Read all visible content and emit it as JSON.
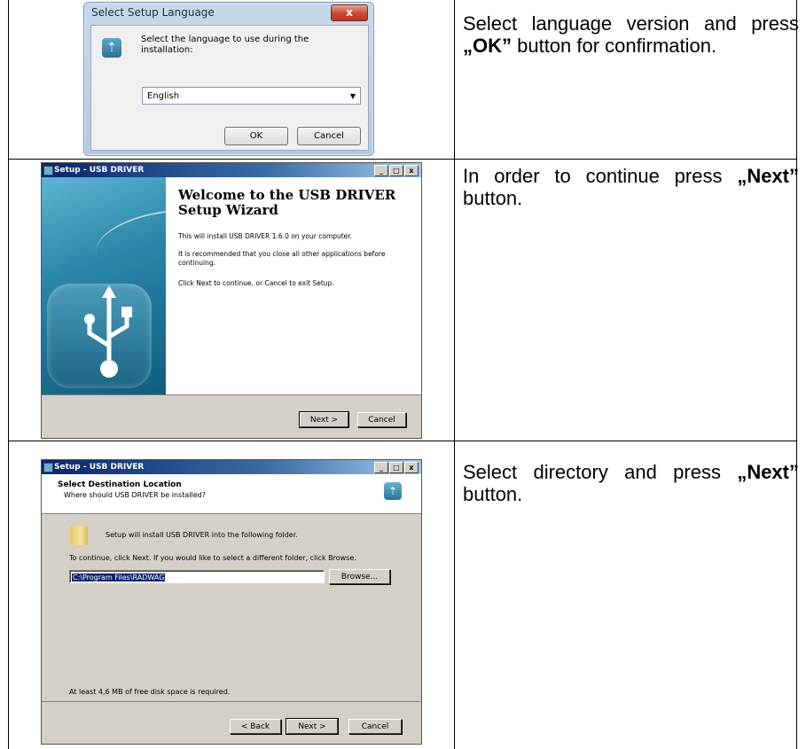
{
  "rows": [
    {
      "instruction_parts": [
        "Select language version and press ",
        "„OK”",
        " button for confirmation."
      ],
      "dialog": {
        "title": "Select Setup Language",
        "close_glyph": "x",
        "icon": "usb-setup-icon",
        "message": "Select the language to use during the installation:",
        "language_selected": "English",
        "ok_label": "OK",
        "cancel_label": "Cancel"
      }
    },
    {
      "instruction_parts": [
        "In order to continue press ",
        "„Next”",
        " button."
      ],
      "wizard": {
        "title": "Setup - USB DRIVER",
        "heading_line1": "Welcome to the USB DRIVER",
        "heading_line2": "Setup Wizard",
        "para1": "This will install USB DRIVER 1.6.0 on your computer.",
        "para2": "It is recommended that you close all other applications before continuing.",
        "para3": "Click Next to continue, or Cancel to exit Setup.",
        "next_label": "Next >",
        "cancel_label": "Cancel"
      }
    },
    {
      "instruction_parts": [
        "Select directory and press ",
        "„Next”",
        " button."
      ],
      "wizard": {
        "title": "Setup - USB DRIVER",
        "header_title": "Select Destination Location",
        "header_subtitle": "Where should USB DRIVER be installed?",
        "folder_text": "Setup will install USB DRIVER into the following folder.",
        "continue_text": "To continue, click Next. If you would like to select a different folder, click Browse.",
        "path_value": "C:\\Program Files\\RADWAG",
        "browse_label": "Browse...",
        "space_text": "At least 4,6 MB of free disk space is required.",
        "back_label": "< Back",
        "next_label": "Next >",
        "cancel_label": "Cancel"
      }
    }
  ],
  "window_buttons": [
    "_",
    "□",
    "x"
  ]
}
